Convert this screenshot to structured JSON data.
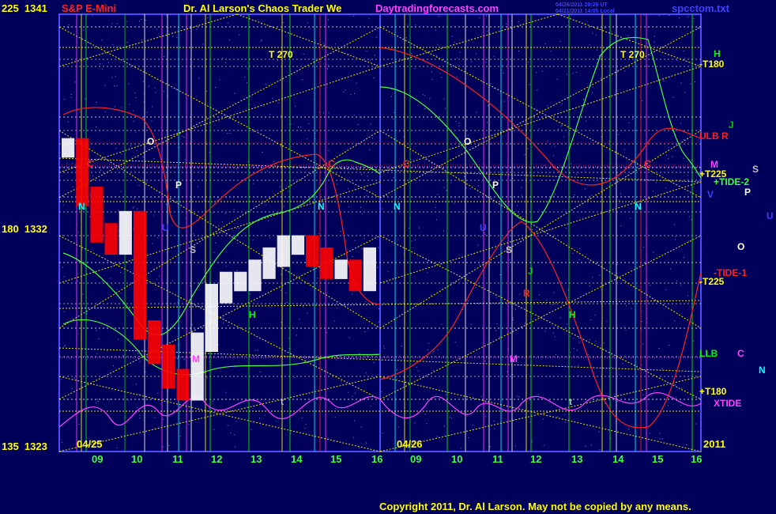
{
  "header": {
    "left_price_top": "225  1341",
    "symbol": "S&P E-Mini",
    "title": "Dr. Al Larson's Chaos Trader We",
    "site": "Daytradingforecasts.com",
    "timestamp_1": "04/26/2011 20:26 UT",
    "timestamp_2": "04/21/2011 14:05 Local",
    "file": "spcctom.txt"
  },
  "left_axis": {
    "mid": "180  1332",
    "bottom": "135  1323"
  },
  "footer": {
    "date_left": "04/25",
    "date_right": "04/26",
    "year": "2011",
    "copyright": "Copyright 2011, Dr. Al Larson. May not be copied by any means."
  },
  "hour_ticks": [
    "09",
    "10",
    "11",
    "12",
    "13",
    "14",
    "15",
    "16",
    "09",
    "10",
    "11",
    "12",
    "13",
    "14",
    "15",
    "16"
  ],
  "right_labels": [
    {
      "text": "H",
      "color": "#00ff00"
    },
    {
      "text": "-T180",
      "color": "#ffff00"
    },
    {
      "text": "J",
      "color": "#00cc00"
    },
    {
      "text": "ULB",
      "color": "#ff2020"
    },
    {
      "text": "R",
      "color": "#ff2020"
    },
    {
      "text": "M",
      "color": "#ff40ff"
    },
    {
      "text": "S",
      "color": "#c0c0c0"
    },
    {
      "text": "+T225",
      "color": "#ffff00"
    },
    {
      "text": "+TIDE-2",
      "color": "#40ff40"
    },
    {
      "text": "V",
      "color": "#4040ff"
    },
    {
      "text": "P",
      "color": "#ffffff"
    },
    {
      "text": "U",
      "color": "#4040ff"
    },
    {
      "text": "O",
      "color": "#ffffff"
    },
    {
      "text": "-TIDE-1",
      "color": "#ff2020"
    },
    {
      "text": "-T225",
      "color": "#ffff00"
    },
    {
      "text": "LLB",
      "color": "#00ff00"
    },
    {
      "text": "C",
      "color": "#ff40ff"
    },
    {
      "text": "N",
      "color": "#00ffff"
    },
    {
      "text": "+T180",
      "color": "#ffff00"
    },
    {
      "text": "XTIDE",
      "color": "#ff40ff"
    }
  ],
  "plot_markers": [
    {
      "text": "T  270",
      "color": "#ffff00"
    },
    {
      "text": "T  270",
      "color": "#ffff00"
    },
    {
      "text": "C",
      "color": "#ff2020"
    },
    {
      "text": "C",
      "color": "#ff2020"
    },
    {
      "text": "C",
      "color": "#ff2020"
    },
    {
      "text": "C",
      "color": "#ff2020"
    },
    {
      "text": "O",
      "color": "#ffffff"
    },
    {
      "text": "O",
      "color": "#ffffff"
    },
    {
      "text": "P",
      "color": "#ffffff"
    },
    {
      "text": "P",
      "color": "#ffffff"
    },
    {
      "text": "N",
      "color": "#00ffff"
    },
    {
      "text": "N",
      "color": "#00ffff"
    },
    {
      "text": "N",
      "color": "#00ffff"
    },
    {
      "text": "N",
      "color": "#00ffff"
    },
    {
      "text": "S",
      "color": "#c0c0c0"
    },
    {
      "text": "S",
      "color": "#c0c0c0"
    },
    {
      "text": "M",
      "color": "#ff40ff"
    },
    {
      "text": "M",
      "color": "#ff40ff"
    },
    {
      "text": "H",
      "color": "#00ff00"
    },
    {
      "text": "H",
      "color": "#00ff00"
    },
    {
      "text": "J",
      "color": "#00cc00"
    },
    {
      "text": "R",
      "color": "#ff2020"
    },
    {
      "text": "U",
      "color": "#4040ff"
    },
    {
      "text": "U",
      "color": "#4040ff"
    },
    {
      "text": "t",
      "color": "#c0c0c0"
    },
    {
      "text": "t",
      "color": "#c0c0c0"
    }
  ],
  "chart_data": {
    "type": "bar",
    "title": "S&P E-Mini",
    "xlabel": "",
    "ylabel": "",
    "ylim": [
      1323,
      1341
    ],
    "y_ticks": [
      1323,
      1332,
      1341
    ],
    "x_ticks": [
      "09",
      "10",
      "11",
      "12",
      "13",
      "14",
      "15",
      "16",
      "09",
      "10",
      "11",
      "12",
      "13",
      "14",
      "15",
      "16"
    ],
    "series": [
      {
        "name": "S&P E-Mini 04/25",
        "values_approx": [
          1335.5,
          1333.5,
          1332.0,
          1331.5,
          1332.5,
          1328.0,
          1327.0,
          1326.0,
          1325.5,
          1327.5,
          1329.5,
          1330.0,
          1330.0,
          1330.5,
          1331.0,
          1331.5,
          1331.5,
          1331.0,
          1330.5,
          1330.5,
          1330.0,
          1331.0
        ]
      },
      {
        "name": "+TIDE-2",
        "color": "#40ff40"
      },
      {
        "name": "-TIDE-1",
        "color": "#ff2020"
      },
      {
        "name": "XTIDE",
        "color": "#ff40ff"
      }
    ],
    "colors": {
      "background": "#00005a",
      "grid": "#c0c0c0",
      "up_bar": "#ffffff",
      "down_bar": "#ff0000",
      "yellow_lines": "#e6e600"
    }
  }
}
